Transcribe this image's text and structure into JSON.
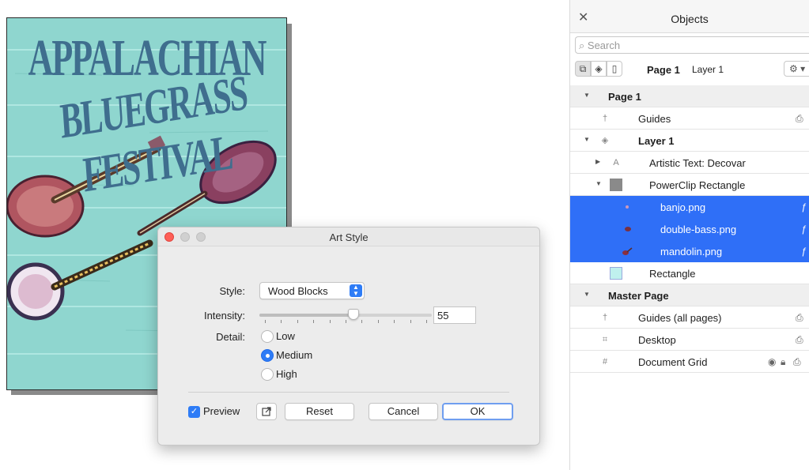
{
  "poster": {
    "title_line1": "APPALACHIAN",
    "title_line2": "BLUEGRASS FESTIVAL"
  },
  "dialog": {
    "title": "Art Style",
    "style_label": "Style:",
    "style_value": "Wood Blocks",
    "intensity_label": "Intensity:",
    "intensity_value": "55",
    "intensity_level": 0.55,
    "detail_label": "Detail:",
    "detail_options": [
      "Low",
      "Medium",
      "High"
    ],
    "detail_selected": "Medium",
    "preview_label": "Preview",
    "reset_label": "Reset",
    "cancel_label": "Cancel",
    "ok_label": "OK"
  },
  "objects_panel": {
    "title": "Objects",
    "search_placeholder": "Search",
    "toolbar_page": "Page 1",
    "toolbar_layer": "Layer 1",
    "rows": {
      "page1": "Page 1",
      "guides": "Guides",
      "layer1": "Layer 1",
      "artistic_text": "Artistic Text: Decovar",
      "powerclip": "PowerClip Rectangle",
      "banjo": "banjo.png",
      "double_bass": "double-bass.png",
      "mandolin": "mandolin.png",
      "rectangle": "Rectangle",
      "master_page": "Master Page",
      "guides_all": "Guides (all pages)",
      "desktop": "Desktop",
      "document_grid": "Document Grid"
    }
  },
  "colors": {
    "accent": "#2f6ff7",
    "poster_bg": "#8fd6cf",
    "poster_text": "#3f6e8e"
  }
}
